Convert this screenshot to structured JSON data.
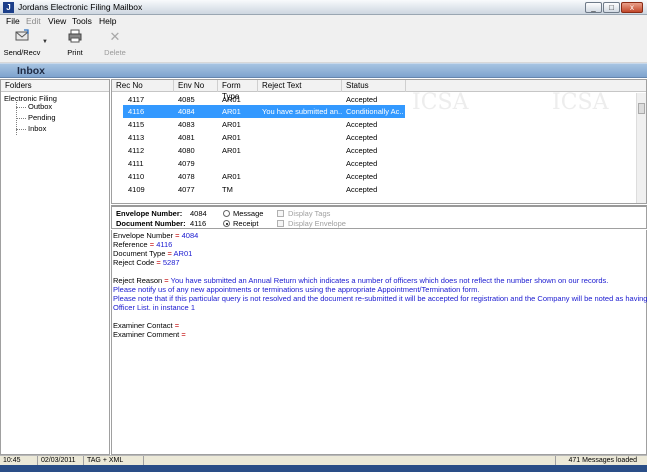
{
  "window": {
    "title": "Jordans Electronic Filing Mailbox",
    "icon_glyph": "J",
    "minimize_glyph": "_",
    "maximize_glyph": "□",
    "close_glyph": "x"
  },
  "menu": {
    "items": [
      {
        "label": "File",
        "enabled": true
      },
      {
        "label": "Edit",
        "enabled": false
      },
      {
        "label": "View",
        "enabled": true
      },
      {
        "label": "Tools",
        "enabled": true
      },
      {
        "label": "Help",
        "enabled": true
      }
    ]
  },
  "toolbar": {
    "send_recv_label": "Send/Recv",
    "print_label": "Print",
    "delete_label": "Delete"
  },
  "inbox_header": {
    "title": "Inbox"
  },
  "folders": {
    "header": "Folders",
    "root": "Electronic Filing",
    "children": [
      "Outbox",
      "Pending",
      "Inbox"
    ]
  },
  "message_list": {
    "columns": [
      "Rec No",
      "Env No",
      "Form Type",
      "Reject Text",
      "Status"
    ],
    "rows": [
      {
        "rec": "4117",
        "env": "4085",
        "form": "AR01",
        "reject": "",
        "status": "Accepted",
        "selected": false
      },
      {
        "rec": "4116",
        "env": "4084",
        "form": "AR01",
        "reject": "You have submitted an...",
        "status": "Conditionally Ac...",
        "selected": true
      },
      {
        "rec": "4115",
        "env": "4083",
        "form": "AR01",
        "reject": "",
        "status": "Accepted",
        "selected": false
      },
      {
        "rec": "4113",
        "env": "4081",
        "form": "AR01",
        "reject": "",
        "status": "Accepted",
        "selected": false
      },
      {
        "rec": "4112",
        "env": "4080",
        "form": "AR01",
        "reject": "",
        "status": "Accepted",
        "selected": false
      },
      {
        "rec": "4111",
        "env": "4079",
        "form": "",
        "reject": "",
        "status": "Accepted",
        "selected": false
      },
      {
        "rec": "4110",
        "env": "4078",
        "form": "AR01",
        "reject": "",
        "status": "Accepted",
        "selected": false
      },
      {
        "rec": "4109",
        "env": "4077",
        "form": "TM",
        "reject": "",
        "status": "Accepted",
        "selected": false
      }
    ]
  },
  "details": {
    "envelope_label": "Envelope Number:",
    "envelope_value": "4084",
    "document_label": "Document Number:",
    "document_value": "4116",
    "radio_message": "Message",
    "radio_receipt": "Receipt",
    "selected_radio": "receipt",
    "check_display_tags": "Display Tags",
    "check_display_envelope": "Display Envelope"
  },
  "receipt": {
    "envelope_number_key": "Envelope Number",
    "envelope_number_val": "4084",
    "reference_key": "Reference",
    "reference_val": "4116",
    "document_type_key": "Document Type",
    "document_type_val": "AR01",
    "reject_code_key": "Reject Code",
    "reject_code_val": "5287",
    "reject_reason_key": "Reject Reason",
    "reject_reason_val": "You have submitted an Annual Return which indicates a number of officers which does not reflect the number shown on our records.",
    "reject_line2": "Please notify us of any new appointments or terminations using the appropriate Appointment/Termination form.",
    "reject_line3": "Please note that if this particular query is not resolved and the document re-submitted it will be accepted for registration and the Company will be noted as having an Inconsisten",
    "reject_line4": "Officer List. in instance 1",
    "examiner_contact_key": "Examiner Contact",
    "examiner_comment_key": "Examiner Comment",
    "equals": "="
  },
  "statusbar": {
    "time": "10:45",
    "date": "02/03/2011",
    "mode": "TAG + XML",
    "messages": "471 Messages loaded"
  },
  "colors": {
    "selection": "#3399ff",
    "header_gradient_top": "#a7c4e2",
    "value_blue": "#1a1ad0",
    "equals_red": "#c00000"
  }
}
